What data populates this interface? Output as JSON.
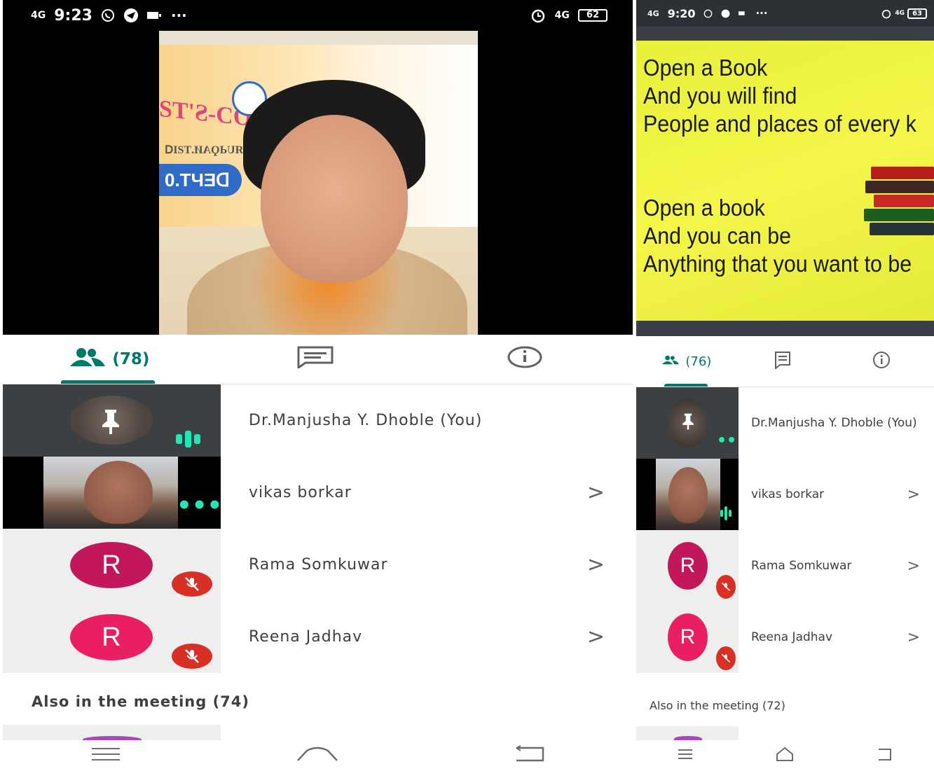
{
  "left": {
    "status": {
      "network": "4G",
      "time": "9:23",
      "overflow": "···",
      "network_right": "4G",
      "battery": "62"
    },
    "tabs": {
      "people_count": "(78)",
      "icons": [
        "people-icon",
        "chat-icon",
        "info-icon"
      ]
    },
    "participants": [
      {
        "name": "Dr.Manjusha Y. Dhoble (You)",
        "state": "speaking",
        "pinned": true
      },
      {
        "name": "vikas borkar",
        "state": "video"
      },
      {
        "name": "Rama Somkuwar",
        "initial": "R",
        "state": "muted",
        "avatar_color": "#c2185b"
      },
      {
        "name": "Reena Jadhav",
        "initial": "R",
        "state": "muted",
        "avatar_color": "#e91e63"
      }
    ],
    "also_in_meeting": "Also in the meeting (74)",
    "chevron": ">"
  },
  "right": {
    "status": {
      "network": "4G",
      "time": "9:20",
      "overflow": "···",
      "network_right": "4G",
      "battery": "63"
    },
    "tabs": {
      "people_count": "(76)",
      "icons": [
        "people-icon",
        "chat-icon",
        "info-icon"
      ]
    },
    "slide": {
      "lines": [
        "Open a Book",
        "And you will find",
        "People and places of every k",
        "Open a book",
        "And you can be",
        "Anything that you want to be"
      ]
    },
    "participants": [
      {
        "name": "Dr.Manjusha Y. Dhoble (You)",
        "state": "idle",
        "pinned": true
      },
      {
        "name": "vikas borkar",
        "state": "speaking"
      },
      {
        "name": "Rama Somkuwar",
        "initial": "R",
        "state": "muted",
        "avatar_color": "#c2185b"
      },
      {
        "name": "Reena Jadhav",
        "initial": "R",
        "state": "muted",
        "avatar_color": "#e91e63"
      }
    ],
    "also_in_meeting": "Also in the meeting (72)",
    "chevron": ">"
  },
  "colors": {
    "accent": "#00796b",
    "mute": "#d93025",
    "speaking": "#1de9b6"
  }
}
